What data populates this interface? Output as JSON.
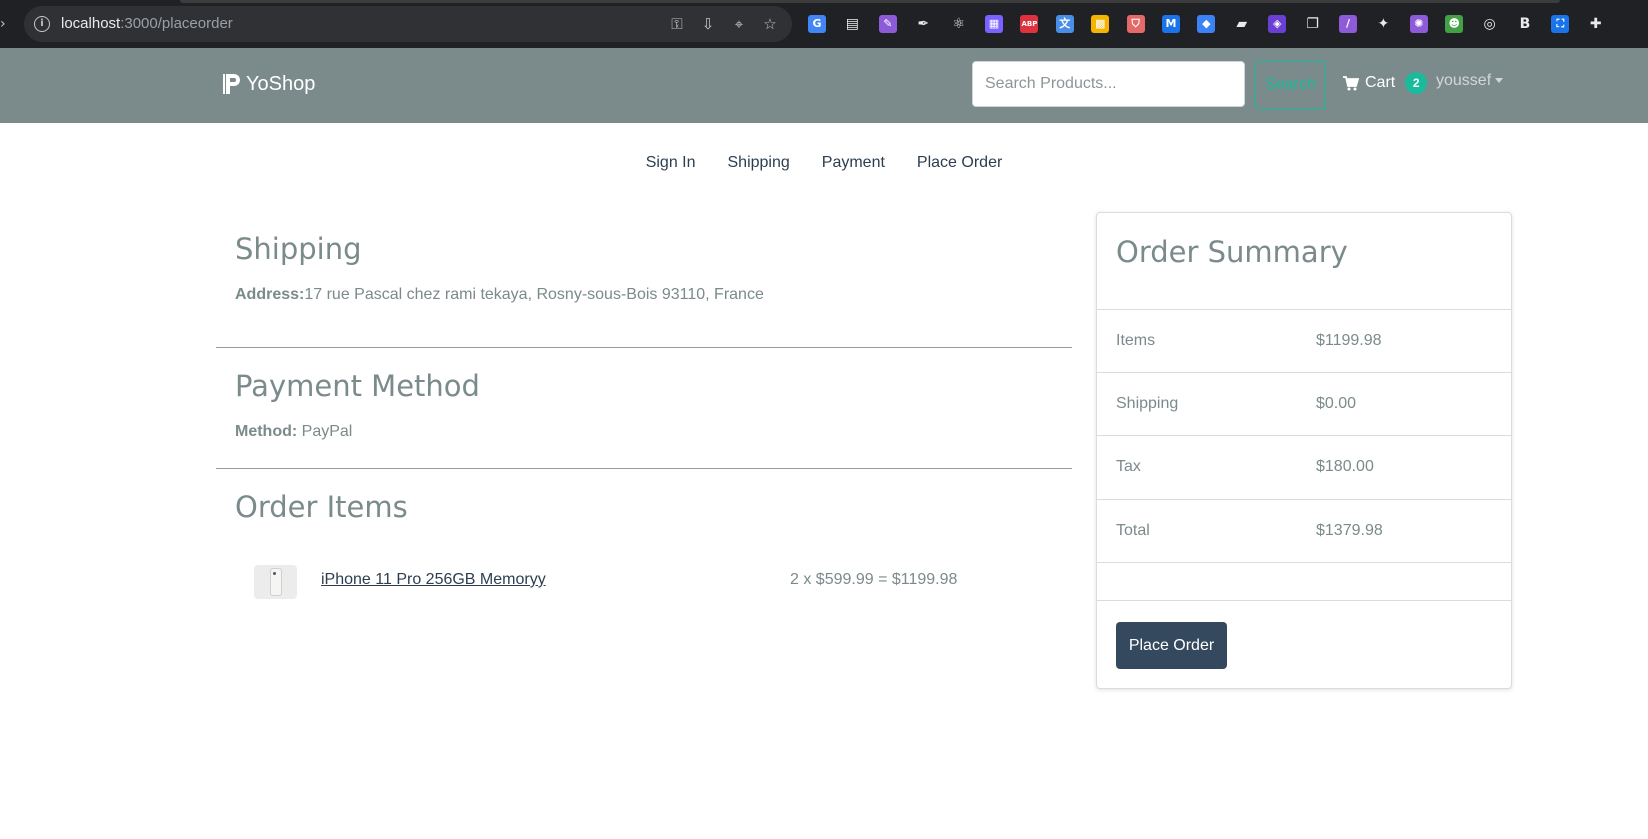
{
  "browser": {
    "url_host": "localhost",
    "url_path": ":3000/placeorder",
    "extensions": [
      {
        "name": "translate-icon",
        "label": "G",
        "color": "#4285f4"
      },
      {
        "name": "calendar-extension-icon",
        "label": "▤",
        "color": "#e8eaed"
      },
      {
        "name": "feather-extension-icon",
        "label": "✎",
        "color": "#8e5bd8"
      },
      {
        "name": "eyedropper-extension-icon",
        "label": "✒",
        "color": "#e8eaed"
      },
      {
        "name": "react-devtools-icon",
        "label": "⚛",
        "color": "#e8eaed"
      },
      {
        "name": "gradient-extension-icon",
        "label": "▦",
        "color": "#7b61ff"
      },
      {
        "name": "adblock-plus-icon",
        "label": "ABP",
        "color": "#e0313f"
      },
      {
        "name": "translator-extension-icon",
        "label": "文",
        "color": "#4a8fe7"
      },
      {
        "name": "tiles-extension-icon",
        "label": "▩",
        "color": "#f4b400"
      },
      {
        "name": "shield-extension-icon",
        "label": "⛉",
        "color": "#e46a6a"
      },
      {
        "name": "m-extension-icon",
        "label": "M",
        "color": "#1a73e8"
      },
      {
        "name": "tag-extension-icon",
        "label": "◆",
        "color": "#3b82f6"
      },
      {
        "name": "eraser-extension-icon",
        "label": "▰",
        "color": "#e8eaed"
      },
      {
        "name": "diamond-extension-icon",
        "label": "◈",
        "color": "#6b3fd4"
      },
      {
        "name": "screens-extension-icon",
        "label": "❐",
        "color": "#e8eaed"
      },
      {
        "name": "vite-extension-icon",
        "label": "/",
        "color": "#8e5bd8"
      },
      {
        "name": "gnu-extension-icon",
        "label": "✦",
        "color": "#e8eaed"
      },
      {
        "name": "gear-extension-icon",
        "label": "✺",
        "color": "#8e5bd8"
      },
      {
        "name": "frog-extension-icon",
        "label": "☻",
        "color": "#43a047"
      },
      {
        "name": "target-extension-icon",
        "label": "◎",
        "color": "#e8eaed"
      },
      {
        "name": "b-extension-icon",
        "label": "B",
        "color": "#e8eaed"
      },
      {
        "name": "screenshot-extension-icon",
        "label": "⛶",
        "color": "#1a73e8"
      },
      {
        "name": "puzzle-extensions-icon",
        "label": "✚",
        "color": "#e8eaed"
      }
    ]
  },
  "navbar": {
    "brand": "YoShop",
    "search_placeholder": "Search Products...",
    "search_button": "Search",
    "cart_label": "Cart",
    "cart_count": "2",
    "user_name": "youssef"
  },
  "steps": [
    "Sign In",
    "Shipping",
    "Payment",
    "Place Order"
  ],
  "shipping": {
    "heading": "Shipping",
    "address_label": "Address:",
    "address_value": "17 rue Pascal chez rami tekaya, Rosny-sous-Bois 93110, France"
  },
  "payment": {
    "heading": "Payment Method",
    "method_label": "Method:",
    "method_value": "PayPal"
  },
  "order_items": {
    "heading": "Order Items",
    "items": [
      {
        "name": "iPhone 11 Pro 256GB Memoryy",
        "price_line": "2 x $599.99 = $1199.98"
      }
    ]
  },
  "summary": {
    "heading": "Order Summary",
    "rows": [
      {
        "label": "Items",
        "value": "$1199.98"
      },
      {
        "label": "Shipping",
        "value": "$0.00"
      },
      {
        "label": "Tax",
        "value": "$180.00"
      },
      {
        "label": "Total",
        "value": "$1379.98"
      }
    ],
    "place_order_button": "Place Order"
  },
  "colors": {
    "navbar_bg": "#7b8a8b",
    "accent": "#18bc9c",
    "primary_button": "#34495e"
  }
}
